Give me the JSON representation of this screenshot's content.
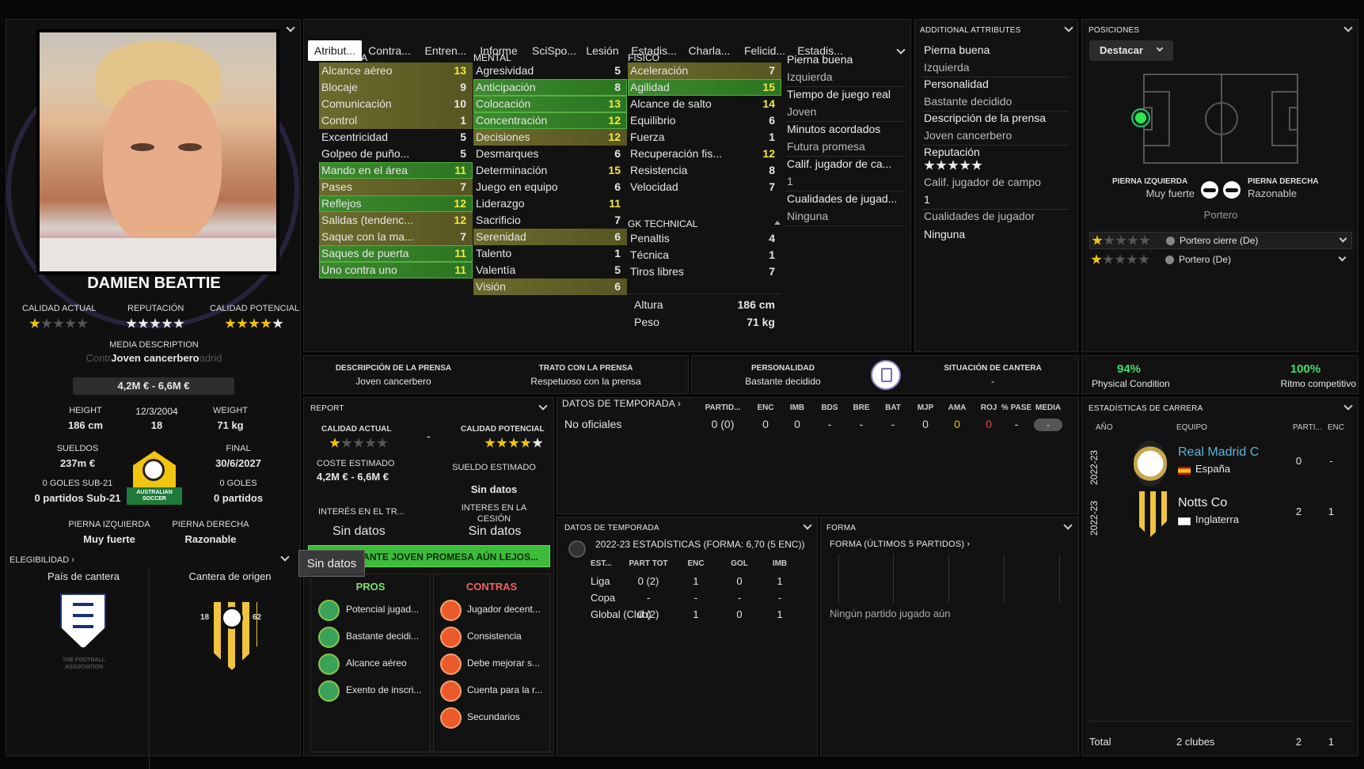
{
  "player": {
    "name": "DAMIEN BEATTIE",
    "ca_label": "CALIDAD ACTUAL",
    "rep_label": "REPUTACIÓN",
    "cp_label": "CALIDAD POTENCIAL",
    "ca_stars": 1,
    "rep_stars": 5,
    "cp_stars": 4.5,
    "media_label": "MEDIA DESCRIPTION",
    "media_value": "Joven cancerbero",
    "media_ghost_left": "Contr",
    "media_ghost_right": "adrid",
    "value_range": "4,2M € - 6,6M €",
    "height_label": "HEIGHT",
    "height": "186 cm",
    "dob": "12/3/2004",
    "age": "18",
    "weight_label": "WEIGHT",
    "weight": "71 kg",
    "wage_label": "SUELDOS",
    "wage": "237m €",
    "end_label": "FINAL",
    "end": "30/6/2027",
    "u21_goals": "0 GOLES SUB-21",
    "u21_apps": "0 partidos Sub-21",
    "goals": "0 GOLES",
    "apps": "0 partidos",
    "left_foot_label": "PIERNA IZQUIERDA",
    "left_foot": "Muy fuerte",
    "right_foot_label": "PIERNA DERECHA",
    "right_foot": "Razonable",
    "elig_label": "ELEGIBILIDAD",
    "elig_chev": "›",
    "nation_label": "País de cantera",
    "origin_label": "Cantera de origen",
    "badge_text": "AUSTRALIAN SOCCER",
    "fa_text": "THE FOOTBALL ASSOCIATION",
    "crest_l": "18",
    "crest_r": "62"
  },
  "tabs": [
    "Atribut...",
    "Contra...",
    "Entren...",
    "Informe",
    "SciSpo...",
    "Lesión",
    "Estadis...",
    "Charla...",
    "Felicid...",
    "Estadis..."
  ],
  "attrs": {
    "porteria_label": "PORTERIA",
    "mental_label": "MENTAL",
    "fisico_label": "FISICO",
    "gk_label": "GK TECHNICAL",
    "porteria": [
      {
        "n": "Alcance aéreo",
        "v": "13",
        "h": "o",
        "y": true
      },
      {
        "n": "Blocaje",
        "v": "9",
        "h": "o"
      },
      {
        "n": "Comunicación",
        "v": "10",
        "h": "o"
      },
      {
        "n": "Control",
        "v": "1",
        "h": "o"
      },
      {
        "n": "Excentricidad",
        "v": "5",
        "h": ""
      },
      {
        "n": "Golpeo de puño...",
        "v": "5",
        "h": ""
      },
      {
        "n": "Mando en el área",
        "v": "11",
        "h": "g",
        "y": true
      },
      {
        "n": "Pases",
        "v": "7",
        "h": "o"
      },
      {
        "n": "Reflejos",
        "v": "12",
        "h": "g",
        "y": true
      },
      {
        "n": "Salidas (tendenc...",
        "v": "12",
        "h": "o",
        "y": true
      },
      {
        "n": "Saque con la ma...",
        "v": "7",
        "h": "o"
      },
      {
        "n": "Saques de puerta",
        "v": "11",
        "h": "g",
        "y": true
      },
      {
        "n": "Uno contra uno",
        "v": "11",
        "h": "g",
        "y": true
      }
    ],
    "mental": [
      {
        "n": "Agresividad",
        "v": "5",
        "h": ""
      },
      {
        "n": "Anticipación",
        "v": "8",
        "h": "g"
      },
      {
        "n": "Colocación",
        "v": "13",
        "h": "g",
        "y": true
      },
      {
        "n": "Concentración",
        "v": "12",
        "h": "g",
        "y": true
      },
      {
        "n": "Decisiones",
        "v": "12",
        "h": "o",
        "y": true
      },
      {
        "n": "Desmarques",
        "v": "6",
        "h": ""
      },
      {
        "n": "Determinación",
        "v": "15",
        "h": "",
        "y": true
      },
      {
        "n": "Juego en equipo",
        "v": "6",
        "h": ""
      },
      {
        "n": "Liderazgo",
        "v": "11",
        "h": "",
        "y": true
      },
      {
        "n": "Sacrificio",
        "v": "7",
        "h": ""
      },
      {
        "n": "Serenidad",
        "v": "6",
        "h": "o"
      },
      {
        "n": "Talento",
        "v": "1",
        "h": ""
      },
      {
        "n": "Valentía",
        "v": "5",
        "h": ""
      },
      {
        "n": "Visión",
        "v": "6",
        "h": "o"
      }
    ],
    "fisico": [
      {
        "n": "Aceleración",
        "v": "7",
        "h": "o"
      },
      {
        "n": "Agilidad",
        "v": "15",
        "h": "g",
        "y": true
      },
      {
        "n": "Alcance de salto",
        "v": "14",
        "h": "",
        "y": true
      },
      {
        "n": "Equilibrio",
        "v": "6",
        "h": ""
      },
      {
        "n": "Fuerza",
        "v": "1",
        "h": ""
      },
      {
        "n": "Recuperación fis...",
        "v": "12",
        "h": "",
        "y": true
      },
      {
        "n": "Resistencia",
        "v": "8",
        "h": ""
      },
      {
        "n": "Velocidad",
        "v": "7",
        "h": ""
      }
    ],
    "gk": [
      {
        "n": "Penaltis",
        "v": "4",
        "h": ""
      },
      {
        "n": "Técnica",
        "v": "1",
        "h": ""
      },
      {
        "n": "Tiros libres",
        "v": "7",
        "h": ""
      }
    ],
    "altura_label": "Altura",
    "altura": "186 cm",
    "peso_label": "Peso",
    "peso": "71 kg",
    "side": [
      "Pierna buena",
      "Izquierda",
      "Tiempo de juego real",
      "Joven",
      "Minutos acordados",
      "Futura promesa",
      "Calif. jugador de ca...",
      "1",
      "Cualidades de jugad...",
      "Ninguna"
    ]
  },
  "additional": {
    "title": "ADDITIONAL ATTRIBUTES",
    "items": [
      "Pierna buena",
      "Izquierda",
      "Personalidad",
      "Bastante decidido",
      "Descripción de la prensa",
      "Joven cancerbero",
      "Reputación",
      "Calif. jugador de campo",
      "1",
      "Cualidades de jugador",
      "Ninguna"
    ],
    "rep_stars": 5
  },
  "positions": {
    "title": "POSICIONES",
    "button": "Destacar",
    "lf_label": "PIERNA IZQUIERDA",
    "lf": "Muy fuerte",
    "rf_label": "PIERNA DERECHA",
    "rf": "Razonable",
    "role": "Portero",
    "roles": [
      {
        "name": "Portero cierre (De)",
        "stars": 1
      },
      {
        "name": "Portero (De)",
        "stars": 1
      }
    ]
  },
  "media_bar": {
    "press_desc_label": "DESCRIPCIÓN DE LA PRENSA",
    "press_desc": "Joven cancerbero",
    "press_label": "TRATO CON LA PRENSA",
    "press": "Respetuoso con la prensa",
    "pers_label": "PERSONALIDAD",
    "pers": "Bastante decidido",
    "cantera_label": "SITUACIÓN DE CANTERA",
    "cantera": "-"
  },
  "condition": {
    "pc": "94%",
    "pc_label": "Physical Condition",
    "mr": "100%",
    "mr_label": "Ritmo competitivo"
  },
  "report": {
    "title": "REPORT",
    "ca_label": "CALIDAD ACTUAL",
    "cp_label": "CALIDAD POTENCIAL",
    "ca_stars": 1,
    "cp_stars": 4.5,
    "dash": "-",
    "cost_label": "COSTE ESTIMADO",
    "cost": "4,2M € - 6,6M €",
    "wage_label": "SUELDO ESTIMADO",
    "wage": "Sin datos",
    "int_tr_label": "INTERÉS EN EL TR...",
    "int_tr": "Sin datos",
    "int_loan_label": "INTERES EN LA CESIÓN",
    "int_loan": "Sin datos",
    "banner": "ANTE JOVEN PROMESA AÚN LEJOS...",
    "tooltip": "Sin datos",
    "pros_label": "PROS",
    "contras_label": "CONTRAS",
    "pros": [
      "Potencial jugad...",
      "Bastante decidi...",
      "Alcance aéreo",
      "Exento de inscri..."
    ],
    "contras": [
      "Jugador decent...",
      "Consistencia",
      "Debe mejorar s...",
      "Cuenta para la r...",
      "Secundarios"
    ]
  },
  "season": {
    "title": "DATOS DE TEMPORADA",
    "cols": [
      "PARTID...",
      "ENC",
      "IMB",
      "BDS",
      "BRE",
      "BAT",
      "MJP",
      "AMA",
      "ROJ",
      "% PASE",
      "MEDIA"
    ],
    "row_label": "No oficiales",
    "row": [
      "0 (0)",
      "0",
      "0",
      "-",
      "-",
      "-",
      "0",
      "0",
      "0",
      "-",
      "-"
    ]
  },
  "season2": {
    "title": "DATOS DE TEMPORADA",
    "sub": "2022-23 ESTADÍSTICAS (FORMA: 6,70 (5 ENC))",
    "cols": [
      "EST...",
      "PART TOT",
      "ENC",
      "GOL",
      "IMB"
    ],
    "rows": [
      [
        "Liga",
        "0 (2)",
        "1",
        "0",
        "1"
      ],
      [
        "Copa",
        "-",
        "-",
        "-",
        "-"
      ],
      [
        "Global (Club)",
        "0 (2)",
        "1",
        "0",
        "1"
      ]
    ]
  },
  "form": {
    "title": "FORMA",
    "sub": "FORMA (ÚLTIMOS 5 PARTIDOS)",
    "empty": "Ningún partido jugado aún"
  },
  "career": {
    "title": "ESTADÍSTICAS DE CARRERA",
    "col_year": "AÑO",
    "col_team": "EQUIPO",
    "col_apps": "PARTI...",
    "col_enc": "ENC",
    "rows": [
      {
        "year": "2022-23",
        "team": "Real Madrid C",
        "country": "España",
        "apps": "0",
        "enc": "-"
      },
      {
        "year": "2022-23",
        "team": "Notts Co",
        "country": "Inglaterra",
        "apps": "2",
        "enc": "1"
      }
    ],
    "total_label": "Total",
    "total_clubs": "2 clubes",
    "total_apps": "2",
    "total_enc": "1"
  },
  "colors": {
    "green": "#3d8a2e",
    "olive": "#6c6a2c",
    "yellow": "#f4ea3a",
    "star": "#f1c40f",
    "link": "#5bb5d6"
  }
}
